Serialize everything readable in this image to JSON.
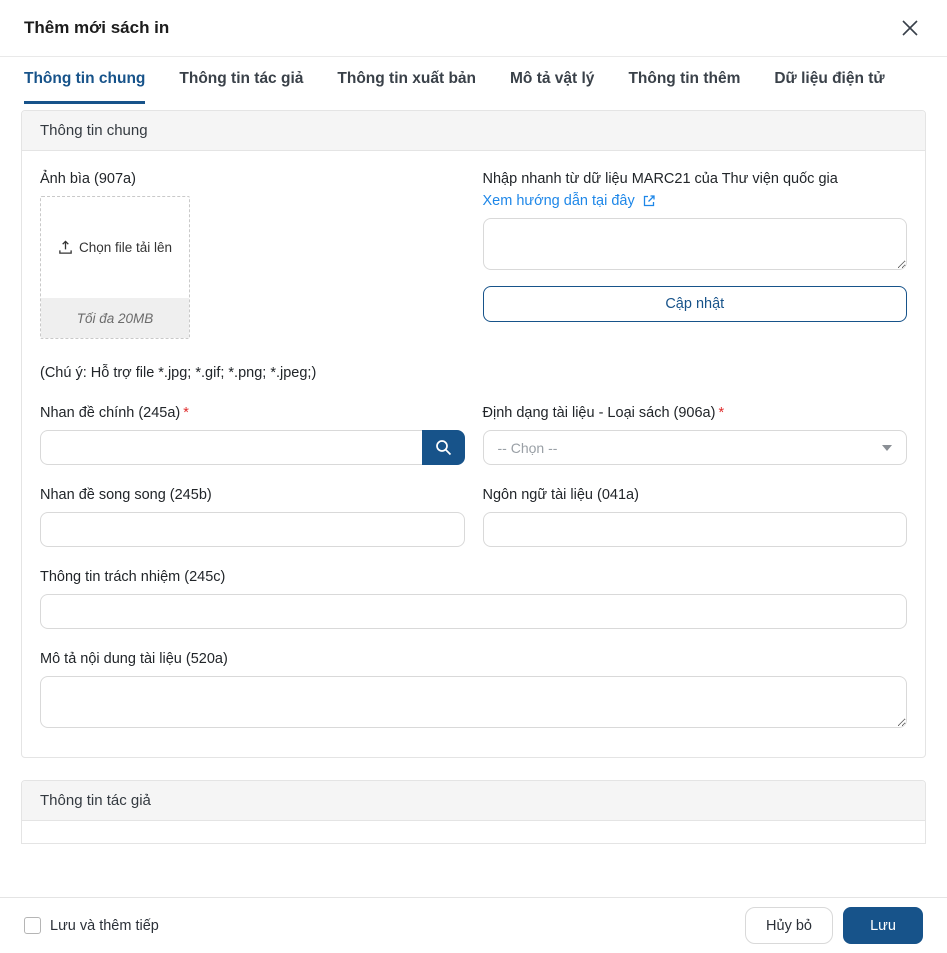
{
  "modal": {
    "title": "Thêm mới sách in"
  },
  "tabs": [
    {
      "label": "Thông tin chung",
      "active": true
    },
    {
      "label": "Thông tin tác giả",
      "active": false
    },
    {
      "label": "Thông tin xuất bản",
      "active": false
    },
    {
      "label": "Mô tả vật lý",
      "active": false
    },
    {
      "label": "Thông tin thêm",
      "active": false
    },
    {
      "label": "Dữ liệu điện tử",
      "active": false
    }
  ],
  "general_section": {
    "header": "Thông tin chung",
    "cover": {
      "label": "Ảnh bìa (907a)",
      "upload_button": "Chọn file tải lên",
      "max_size": "Tối đa 20MB",
      "note": "(Chú ý: Hỗ trợ file *.jpg; *.gif; *.png; *.jpeg;)"
    },
    "marc": {
      "title": "Nhập nhanh từ dữ liệu MARC21 của Thư viện quốc gia",
      "link_label": "Xem hướng dẫn tại đây",
      "input_value": "",
      "update_button": "Cập nhật"
    },
    "fields": {
      "main_title": {
        "label": "Nhan đề chính (245a)",
        "value": ""
      },
      "doc_format": {
        "label": "Định dạng tài liệu - Loại sách (906a)",
        "selected": "-- Chọn --"
      },
      "parallel_title": {
        "label": "Nhan đề song song (245b)",
        "value": ""
      },
      "language": {
        "label": "Ngôn ngữ tài liệu (041a)",
        "value": ""
      },
      "responsibility": {
        "label": "Thông tin trách nhiệm (245c)",
        "value": ""
      },
      "description": {
        "label": "Mô tả nội dung tài liệu (520a)",
        "value": ""
      }
    }
  },
  "author_section": {
    "header": "Thông tin tác giả"
  },
  "footer": {
    "checkbox_label": "Lưu và thêm tiếp",
    "checkbox_checked": false,
    "cancel_button": "Hủy bỏ",
    "save_button": "Lưu"
  },
  "misc": {
    "required_marker": "*"
  },
  "colors": {
    "primary_navy": "#17538a",
    "link_blue": "#1e87e8",
    "required_red": "#e02b2b",
    "section_header_bg": "#f5f5f5"
  }
}
